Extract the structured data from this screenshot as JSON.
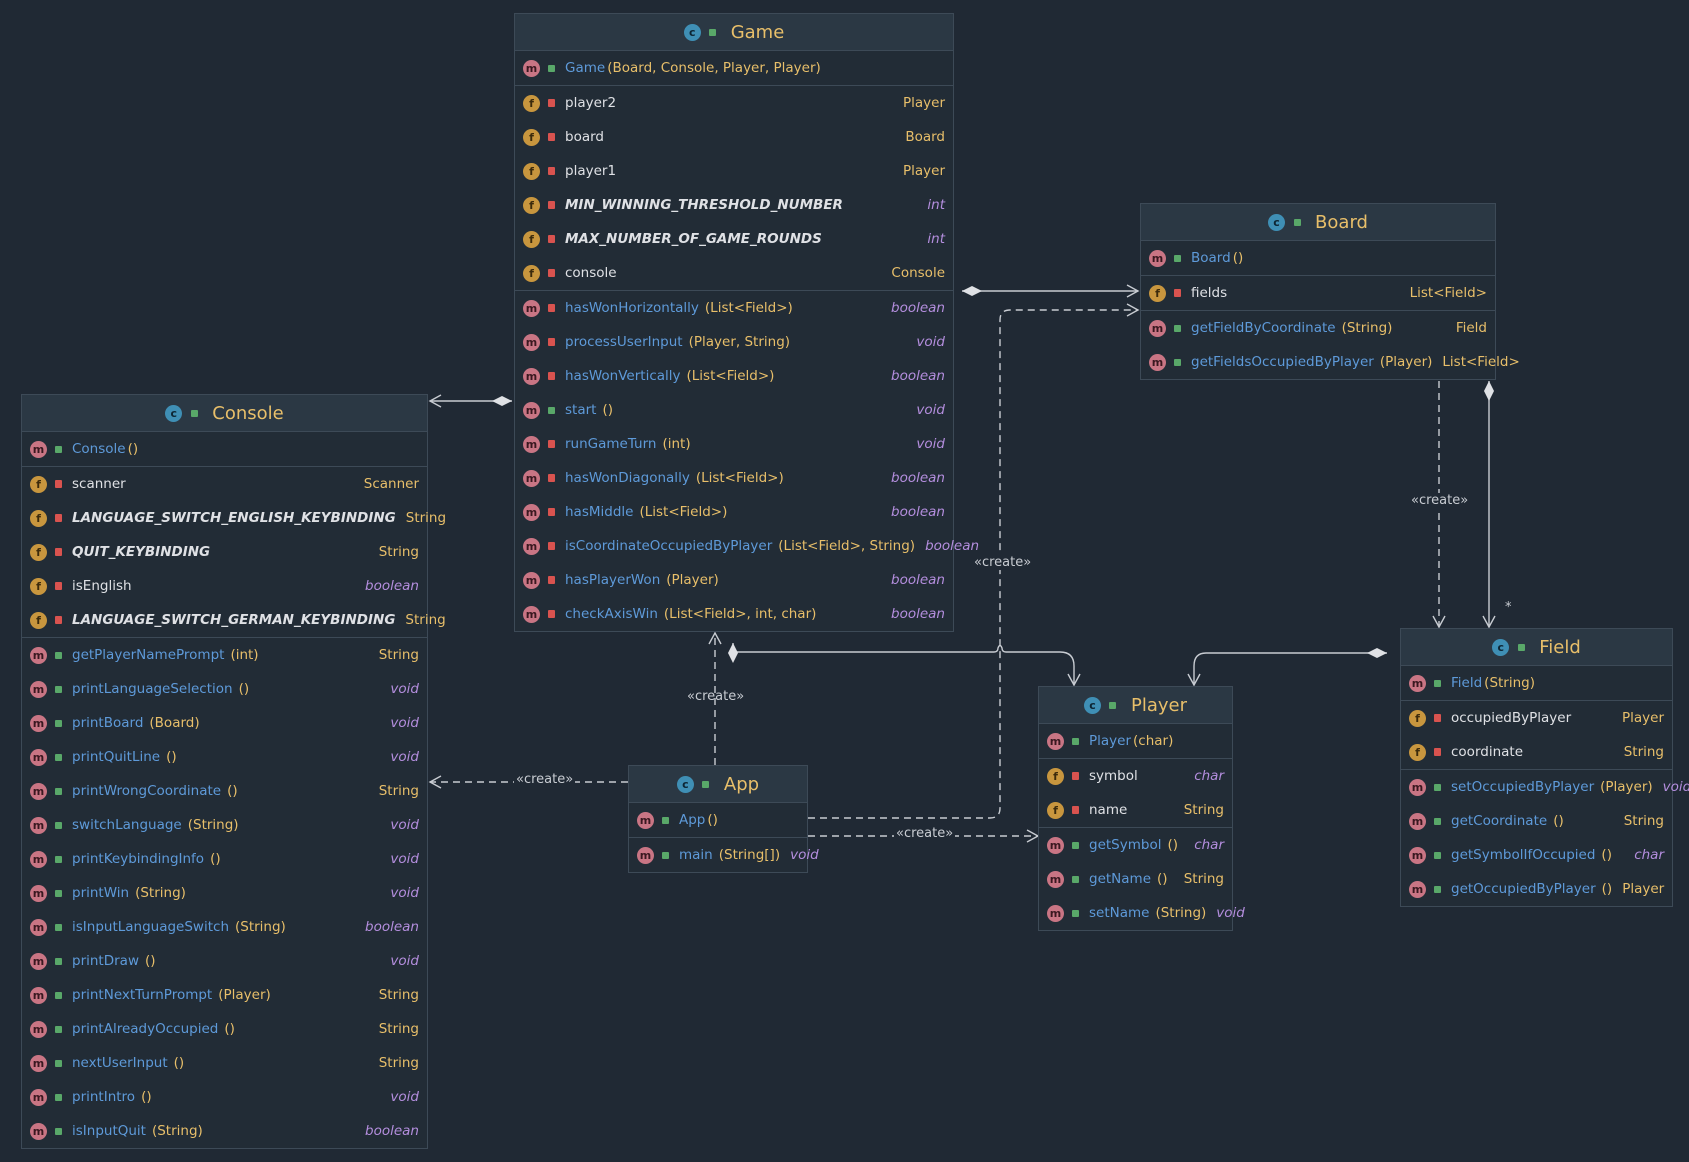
{
  "classes": {
    "game": {
      "name": "Game",
      "rows": [
        {
          "kind": "m",
          "vis": "pub",
          "name": "Game",
          "params": "(Board, Console, Player, Player)",
          "type": "",
          "ctor": true
        },
        {
          "kind": "f",
          "vis": "priv",
          "name": "player2",
          "params": "",
          "type": "Player",
          "sep": true
        },
        {
          "kind": "f",
          "vis": "priv",
          "name": "board",
          "params": "",
          "type": "Board"
        },
        {
          "kind": "f",
          "vis": "priv",
          "name": "player1",
          "params": "",
          "type": "Player"
        },
        {
          "kind": "f",
          "vis": "priv",
          "name": "MIN_WINNING_THRESHOLD_NUMBER",
          "params": "",
          "type": "int",
          "static": true,
          "prim": true
        },
        {
          "kind": "f",
          "vis": "priv",
          "name": "MAX_NUMBER_OF_GAME_ROUNDS",
          "params": "",
          "type": "int",
          "static": true,
          "prim": true
        },
        {
          "kind": "f",
          "vis": "priv",
          "name": "console",
          "params": "",
          "type": "Console"
        },
        {
          "kind": "m",
          "vis": "priv",
          "name": "hasWonHorizontally",
          "params": "(List<Field>)",
          "type": "boolean",
          "prim": true,
          "sep": true
        },
        {
          "kind": "m",
          "vis": "priv",
          "name": "processUserInput",
          "params": "(Player, String)",
          "type": "void",
          "prim": true
        },
        {
          "kind": "m",
          "vis": "priv",
          "name": "hasWonVertically",
          "params": "(List<Field>)",
          "type": "boolean",
          "prim": true
        },
        {
          "kind": "m",
          "vis": "pub",
          "name": "start",
          "params": "()",
          "type": "void",
          "prim": true
        },
        {
          "kind": "m",
          "vis": "priv",
          "name": "runGameTurn",
          "params": "(int)",
          "type": "void",
          "prim": true
        },
        {
          "kind": "m",
          "vis": "priv",
          "name": "hasWonDiagonally",
          "params": "(List<Field>)",
          "type": "boolean",
          "prim": true
        },
        {
          "kind": "m",
          "vis": "priv",
          "name": "hasMiddle",
          "params": "(List<Field>)",
          "type": "boolean",
          "prim": true
        },
        {
          "kind": "m",
          "vis": "priv",
          "name": "isCoordinateOccupiedByPlayer",
          "params": "(List<Field>, String)",
          "type": "boolean",
          "prim": true
        },
        {
          "kind": "m",
          "vis": "priv",
          "name": "hasPlayerWon",
          "params": "(Player)",
          "type": "boolean",
          "prim": true
        },
        {
          "kind": "m",
          "vis": "priv",
          "name": "checkAxisWin",
          "params": "(List<Field>, int, char)",
          "type": "boolean",
          "prim": true
        }
      ]
    },
    "board": {
      "name": "Board",
      "rows": [
        {
          "kind": "m",
          "vis": "pub",
          "name": "Board",
          "params": "()",
          "type": "",
          "ctor": true
        },
        {
          "kind": "f",
          "vis": "priv",
          "name": "fields",
          "params": "",
          "type": "List<Field>",
          "sep": true
        },
        {
          "kind": "m",
          "vis": "pub",
          "name": "getFieldByCoordinate",
          "params": "(String)",
          "type": "Field",
          "sep": true
        },
        {
          "kind": "m",
          "vis": "pub",
          "name": "getFieldsOccupiedByPlayer",
          "params": "(Player)",
          "type": "List<Field>"
        }
      ]
    },
    "console": {
      "name": "Console",
      "rows": [
        {
          "kind": "m",
          "vis": "pub",
          "name": "Console",
          "params": "()",
          "type": "",
          "ctor": true
        },
        {
          "kind": "f",
          "vis": "priv",
          "name": "scanner",
          "params": "",
          "type": "Scanner",
          "sep": true
        },
        {
          "kind": "f",
          "vis": "priv",
          "name": "LANGUAGE_SWITCH_ENGLISH_KEYBINDING",
          "params": "",
          "type": "String",
          "static": true
        },
        {
          "kind": "f",
          "vis": "priv",
          "name": "QUIT_KEYBINDING",
          "params": "",
          "type": "String",
          "static": true
        },
        {
          "kind": "f",
          "vis": "priv",
          "name": "isEnglish",
          "params": "",
          "type": "boolean",
          "prim": true
        },
        {
          "kind": "f",
          "vis": "priv",
          "name": "LANGUAGE_SWITCH_GERMAN_KEYBINDING",
          "params": "",
          "type": "String",
          "static": true
        },
        {
          "kind": "m",
          "vis": "pub",
          "name": "getPlayerNamePrompt",
          "params": "(int)",
          "type": "String",
          "sep": true
        },
        {
          "kind": "m",
          "vis": "pub",
          "name": "printLanguageSelection",
          "params": "()",
          "type": "void",
          "prim": true
        },
        {
          "kind": "m",
          "vis": "pub",
          "name": "printBoard",
          "params": "(Board)",
          "type": "void",
          "prim": true
        },
        {
          "kind": "m",
          "vis": "pub",
          "name": "printQuitLine",
          "params": "()",
          "type": "void",
          "prim": true
        },
        {
          "kind": "m",
          "vis": "pub",
          "name": "printWrongCoordinate",
          "params": "()",
          "type": "String"
        },
        {
          "kind": "m",
          "vis": "pub",
          "name": "switchLanguage",
          "params": "(String)",
          "type": "void",
          "prim": true
        },
        {
          "kind": "m",
          "vis": "pub",
          "name": "printKeybindingInfo",
          "params": "()",
          "type": "void",
          "prim": true
        },
        {
          "kind": "m",
          "vis": "pub",
          "name": "printWin",
          "params": "(String)",
          "type": "void",
          "prim": true
        },
        {
          "kind": "m",
          "vis": "pub",
          "name": "isInputLanguageSwitch",
          "params": "(String)",
          "type": "boolean",
          "prim": true
        },
        {
          "kind": "m",
          "vis": "pub",
          "name": "printDraw",
          "params": "()",
          "type": "void",
          "prim": true
        },
        {
          "kind": "m",
          "vis": "pub",
          "name": "printNextTurnPrompt",
          "params": "(Player)",
          "type": "String"
        },
        {
          "kind": "m",
          "vis": "pub",
          "name": "printAlreadyOccupied",
          "params": "()",
          "type": "String"
        },
        {
          "kind": "m",
          "vis": "pub",
          "name": "nextUserInput",
          "params": "()",
          "type": "String"
        },
        {
          "kind": "m",
          "vis": "pub",
          "name": "printIntro",
          "params": "()",
          "type": "void",
          "prim": true
        },
        {
          "kind": "m",
          "vis": "pub",
          "name": "isInputQuit",
          "params": "(String)",
          "type": "boolean",
          "prim": true
        }
      ]
    },
    "app": {
      "name": "App",
      "rows": [
        {
          "kind": "m",
          "vis": "pub",
          "name": "App",
          "params": "()",
          "type": "",
          "ctor": true
        },
        {
          "kind": "m",
          "vis": "pub",
          "name": "main",
          "params": "(String[])",
          "type": "void",
          "prim": true,
          "sep": true
        }
      ]
    },
    "player": {
      "name": "Player",
      "rows": [
        {
          "kind": "m",
          "vis": "pub",
          "name": "Player",
          "params": "(char)",
          "type": "",
          "ctor": true
        },
        {
          "kind": "f",
          "vis": "priv",
          "name": "symbol",
          "params": "",
          "type": "char",
          "prim": true,
          "sep": true
        },
        {
          "kind": "f",
          "vis": "priv",
          "name": "name",
          "params": "",
          "type": "String"
        },
        {
          "kind": "m",
          "vis": "pub",
          "name": "getSymbol",
          "params": "()",
          "type": "char",
          "prim": true,
          "sep": true
        },
        {
          "kind": "m",
          "vis": "pub",
          "name": "getName",
          "params": "()",
          "type": "String"
        },
        {
          "kind": "m",
          "vis": "pub",
          "name": "setName",
          "params": "(String)",
          "type": "void",
          "prim": true
        }
      ]
    },
    "field": {
      "name": "Field",
      "rows": [
        {
          "kind": "m",
          "vis": "pub",
          "name": "Field",
          "params": "(String)",
          "type": "",
          "ctor": true
        },
        {
          "kind": "f",
          "vis": "priv",
          "name": "occupiedByPlayer",
          "params": "",
          "type": "Player",
          "sep": true
        },
        {
          "kind": "f",
          "vis": "priv",
          "name": "coordinate",
          "params": "",
          "type": "String"
        },
        {
          "kind": "m",
          "vis": "pub",
          "name": "setOccupiedByPlayer",
          "params": "(Player)",
          "type": "void",
          "prim": true,
          "sep": true
        },
        {
          "kind": "m",
          "vis": "pub",
          "name": "getCoordinate",
          "params": "()",
          "type": "String"
        },
        {
          "kind": "m",
          "vis": "pub",
          "name": "getSymbolIfOccupied",
          "params": "()",
          "type": "char",
          "prim": true
        },
        {
          "kind": "m",
          "vis": "pub",
          "name": "getOccupiedByPlayer",
          "params": "()",
          "type": "Player"
        }
      ]
    }
  },
  "labels": {
    "create_app_game": "«create»",
    "create_app_console": "«create»",
    "create_app_board": "«create»",
    "create_app_player": "«create»",
    "create_board_field": "«create»",
    "multiplicity_fields": "*"
  },
  "colors": {
    "background": "#202934",
    "line": "#c8ccd2",
    "classname": "#e8bf6a",
    "method": "#5e9ad9"
  }
}
